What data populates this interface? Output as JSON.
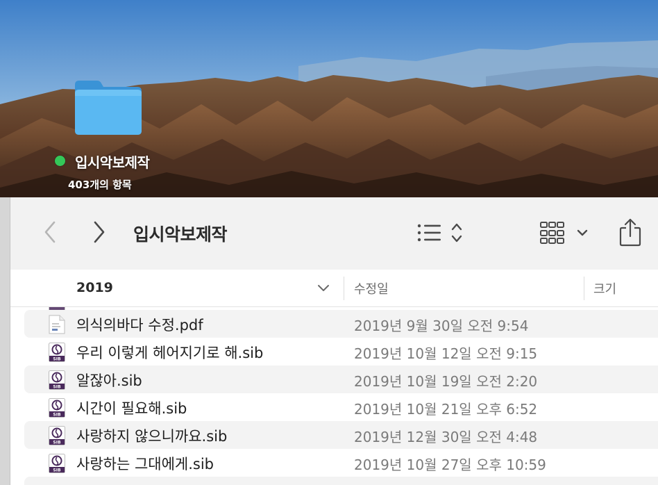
{
  "desktop": {
    "folder_label": "입시악보제작",
    "folder_sub": "403개의 항목",
    "tag_color": "#34c759"
  },
  "toolbar": {
    "title": "입시악보제작",
    "back_icon": "chevron-left-icon",
    "forward_icon": "chevron-right-icon",
    "list_view_icon": "list-view-icon",
    "group_icon": "icon-grid-view-icon",
    "share_icon": "share-icon"
  },
  "columns": {
    "name_group": "2019",
    "date": "수정일",
    "size": "크기"
  },
  "files": [
    {
      "name": "의식의바다 수정.pdf",
      "date": "2019년 9월 30일 오전 9:54",
      "type": "pdf"
    },
    {
      "name": "우리 이렇게 헤어지기로 해.sib",
      "date": "2019년 10월 12일 오전 9:15",
      "type": "sib"
    },
    {
      "name": "알잖아.sib",
      "date": "2019년 10월 19일 오전 2:20",
      "type": "sib"
    },
    {
      "name": "시간이 필요해.sib",
      "date": "2019년 10월 21일 오후 6:52",
      "type": "sib"
    },
    {
      "name": "사랑하지 않으니까요.sib",
      "date": "2019년 12월 30일 오전 4:48",
      "type": "sib"
    },
    {
      "name": "사랑하는 그대에게.sib",
      "date": "2019년 10월 27일 오후 10:59",
      "type": "sib"
    }
  ],
  "colors": {
    "accent_folder": "#5ab8f2",
    "row_alt": "#f3f3f3",
    "sib_icon": "#4a2a5c"
  }
}
